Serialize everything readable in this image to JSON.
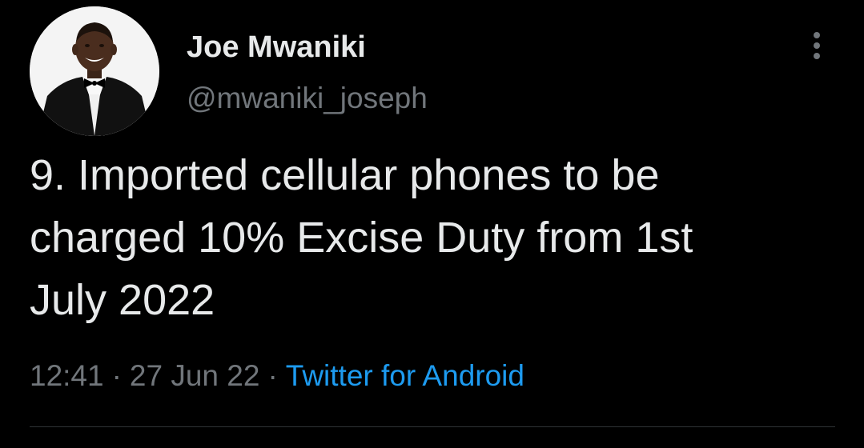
{
  "author": {
    "name": "Joe Mwaniki",
    "handle": "@mwaniki_joseph"
  },
  "tweet": {
    "text": "9. Imported cellular phones to be\ncharged 10% Excise Duty from 1st\nJuly 2022",
    "time": "12:41",
    "date": "27 Jun 22",
    "source": "Twitter for Android"
  },
  "meta_separator": "·",
  "colors": {
    "background": "#000000",
    "text_primary": "#e7e9ea",
    "text_secondary": "#71767b",
    "accent": "#1d9bf0",
    "divider": "#2f3336"
  },
  "icons": {
    "more": "more-vertical-icon"
  }
}
